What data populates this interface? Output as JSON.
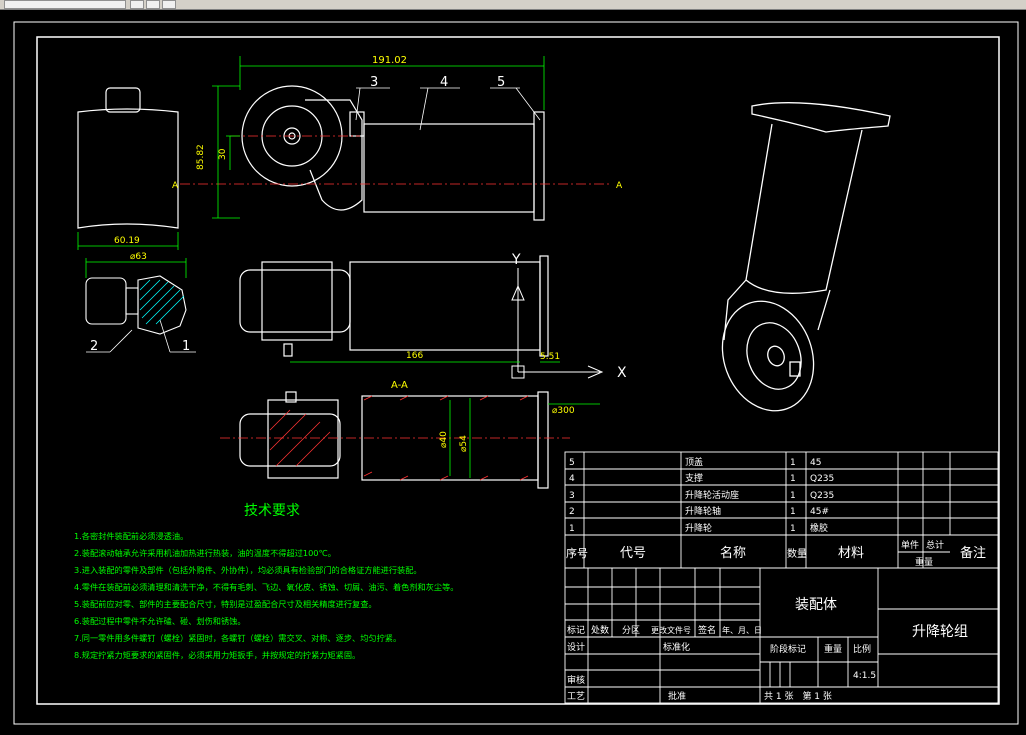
{
  "drawing": {
    "title": "升降轮组",
    "drawing_type": "装配体",
    "scale_label": "比例",
    "scale": "4:1.5",
    "sheet_info": "共 1 张　第 1 张",
    "weight_label": "重量",
    "stage_label": "阶段标记"
  },
  "dimensions": {
    "overall_length": "191.02",
    "height_a": "85.82",
    "height_b": "30",
    "width": "60.19",
    "hub_dia": "⌀63",
    "length_b": "166",
    "offset": "5.51",
    "dia_b": "⌀40",
    "dia_c": "⌀54",
    "flange": "⌀300",
    "section": "A-A",
    "axis_y": "Y",
    "axis_x": "X",
    "section_mark": "A"
  },
  "balloons": [
    "3",
    "4",
    "5",
    "2",
    "1"
  ],
  "tech": {
    "title": "技术要求",
    "items": [
      "1.各密封件装配前必须浸透油。",
      "2.装配滚动轴承允许采用机油加热进行热装，油的温度不得超过100℃。",
      "3.进入装配的零件及部件（包括外购件、外协件），均必须具有检验部门的合格证方能进行装配。",
      "4.零件在装配前必须清理和清洗干净，不得有毛刺、飞边、氧化皮、锈蚀、切屑、油污、着色剂和灰尘等。",
      "5.装配前应对零、部件的主要配合尺寸，特别是过盈配合尺寸及相关精度进行复查。",
      "6.装配过程中零件不允许磕、碰、划伤和锈蚀。",
      "7.同一零件用多件螺钉（螺栓）紧固时，各螺钉（螺栓）需交叉、对称、逐步、均匀拧紧。",
      "8.规定拧紧力矩要求的紧固件，必须采用力矩扳手，并按规定的拧紧力矩紧固。"
    ]
  },
  "bom": {
    "headers": {
      "no": "序号",
      "code": "代号",
      "name": "名称",
      "qty": "数量",
      "material": "材料",
      "single": "单件",
      "total": "总计",
      "weight": "重量",
      "remark": "备注"
    },
    "rows": [
      {
        "no": "5",
        "name": "顶盖",
        "qty": "1",
        "material": "45"
      },
      {
        "no": "4",
        "name": "支撑",
        "qty": "1",
        "material": "Q235"
      },
      {
        "no": "3",
        "name": "升降轮活动座",
        "qty": "1",
        "material": "Q235"
      },
      {
        "no": "2",
        "name": "升降轮轴",
        "qty": "1",
        "material": "45#"
      },
      {
        "no": "1",
        "name": "升降轮",
        "qty": "1",
        "material": "橡胶"
      }
    ]
  },
  "titleblock": {
    "mark": "标记",
    "count": "处数",
    "zone": "分区",
    "change_doc": "更改文件号",
    "sign": "签名",
    "date": "年、月、日",
    "design": "设计",
    "standard": "标准化",
    "review": "审核",
    "process": "工艺",
    "approve": "批准"
  }
}
